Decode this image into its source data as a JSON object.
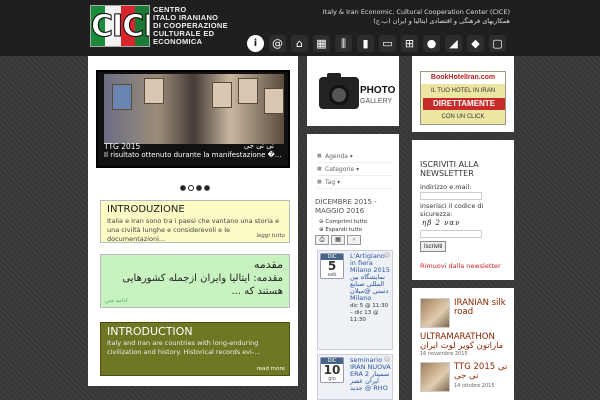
{
  "header": {
    "logo_word": "CICE",
    "logo_text": [
      "Centro",
      "Italo Iraniano",
      "di Cooperazione",
      "Culturale ed",
      "Economica"
    ],
    "tagline_en": "Italy & Iran Economic, Cultural Cooperation Center (CICE)",
    "tagline_fa": "همکاریهای فرهنگی و اقتصادی ایتالیا و ایران (ب.ج)",
    "icons": [
      "info-icon",
      "at-icon",
      "home-icon",
      "calendar-icon",
      "columns-icon",
      "chart-icon",
      "book-icon",
      "cart-icon",
      "ball-icon",
      "italy-map-icon",
      "iran-map-icon",
      "flickr-icon"
    ]
  },
  "slider": {
    "title": "TTG 2015",
    "title_fa": "تی تی جی",
    "caption": "Il risultato ottenuto durante la manifestazione �..."
  },
  "intro_it": {
    "title": "INTRODUZIONE",
    "text": "Italia e Iran sono tra i paesi che vantano una storia e una civiltà lunghe e considerevoli e le documentazioni...",
    "more": "leggi tutto"
  },
  "intro_fa": {
    "title": "مقدمه",
    "text": "مقدمه: ایتالیا وایران ازجمله کشورهایی هستند که ...",
    "more": "ادامه متن"
  },
  "intro_en": {
    "title": "INTRODUCTION",
    "text": "Italy and Iran are countries with long-enduring civilization and history. Historical records evi-...",
    "more": "read more"
  },
  "gallery": {
    "title": "PHOTO",
    "subtitle": "GALLERY"
  },
  "calendar": {
    "filters": [
      "Agenda ▾",
      "Categorie ▾",
      "Tag ▾"
    ],
    "range": "DICEMBRE 2015 - MAGGIO 2016",
    "opt1": "⊖ Comprimi tutto",
    "opt2": "⊕ Espandi tutto",
    "events": [
      {
        "month": "DIC",
        "day": "5",
        "weekday": "sab",
        "title": "L'Artigiano in fiera Milano 2015 نمایشگاه بین المللی صنایع دستی @میلان Milano",
        "when": "dic 5 @ 11:30 – dic 13 @ 11:30"
      },
      {
        "month": "DIC",
        "day": "10",
        "weekday": "gio",
        "title": "seminario IRAN NUOVA ERA سمینار 2 ایران عصر جدید @ RHO"
      }
    ]
  },
  "banner": {
    "top": "BookHotelIran.com",
    "mid": "IL TUO HOTEL IN IRAN",
    "bold": "DIRETTAMENTE",
    "bottom": "CON UN CLICK"
  },
  "newsletter": {
    "title": "ISCRIVITI ALLA NEWSLETTER",
    "email_label": "indirizzo e.mail:",
    "code_label": "inserisci il codice di sicurezza:",
    "captcha": "ηβ 2 ναν",
    "button": "Iscriviti",
    "unsubscribe": "Rimuovi dalla newsletter"
  },
  "news": [
    {
      "title": "IRANIAN silk road"
    },
    {
      "title": "ULTRAMARATHON ماراتون کویر لوت ایران",
      "date": "16 novembre 2015"
    },
    {
      "title": "TTG 2015 تی تی جی",
      "date": "14 ottobre 2015"
    }
  ]
}
